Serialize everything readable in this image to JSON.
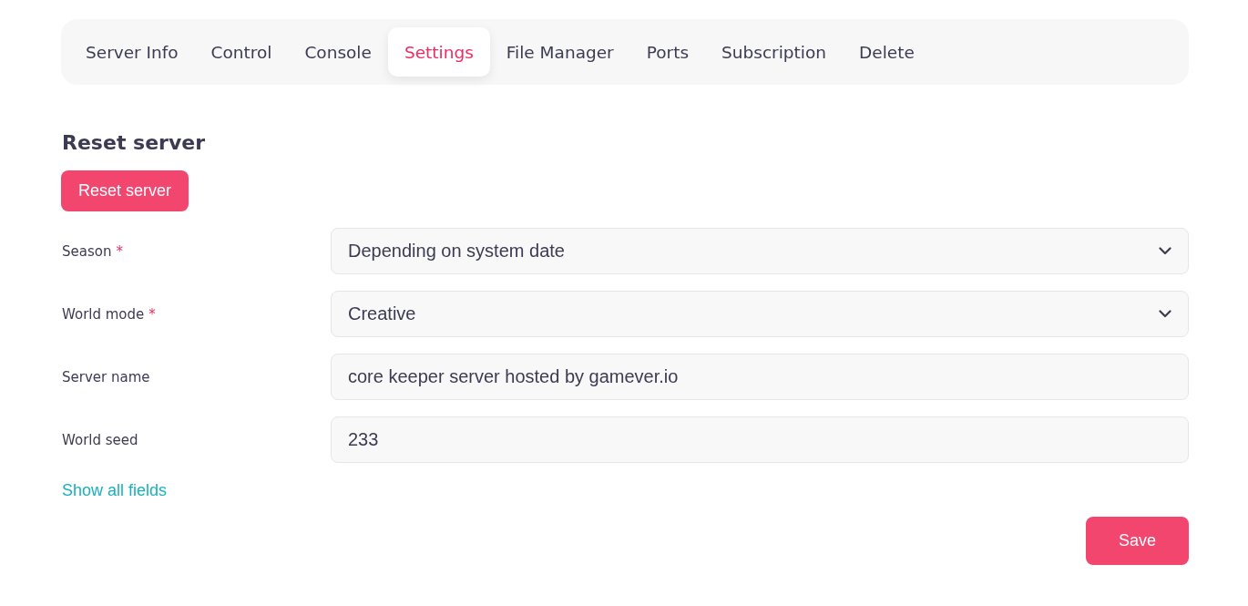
{
  "tabs": [
    {
      "label": "Server Info",
      "selected": false
    },
    {
      "label": "Control",
      "selected": false
    },
    {
      "label": "Console",
      "selected": false
    },
    {
      "label": "Settings",
      "selected": true
    },
    {
      "label": "File Manager",
      "selected": false
    },
    {
      "label": "Ports",
      "selected": false
    },
    {
      "label": "Subscription",
      "selected": false
    },
    {
      "label": "Delete",
      "selected": false
    }
  ],
  "reset_section": {
    "title": "Reset server",
    "button": "Reset server"
  },
  "required_mark": "*",
  "fields": [
    {
      "kind": "select",
      "label": "Season",
      "required": true,
      "value": "Depending on system date"
    },
    {
      "kind": "select",
      "label": "World mode",
      "required": true,
      "value": "Creative"
    },
    {
      "kind": "text",
      "label": "Server name",
      "required": false,
      "value": "core keeper server hosted by gamever.io"
    },
    {
      "kind": "text",
      "label": "World seed",
      "required": false,
      "value": "233"
    }
  ],
  "show_all_link": "Show all fields",
  "save_button": "Save"
}
